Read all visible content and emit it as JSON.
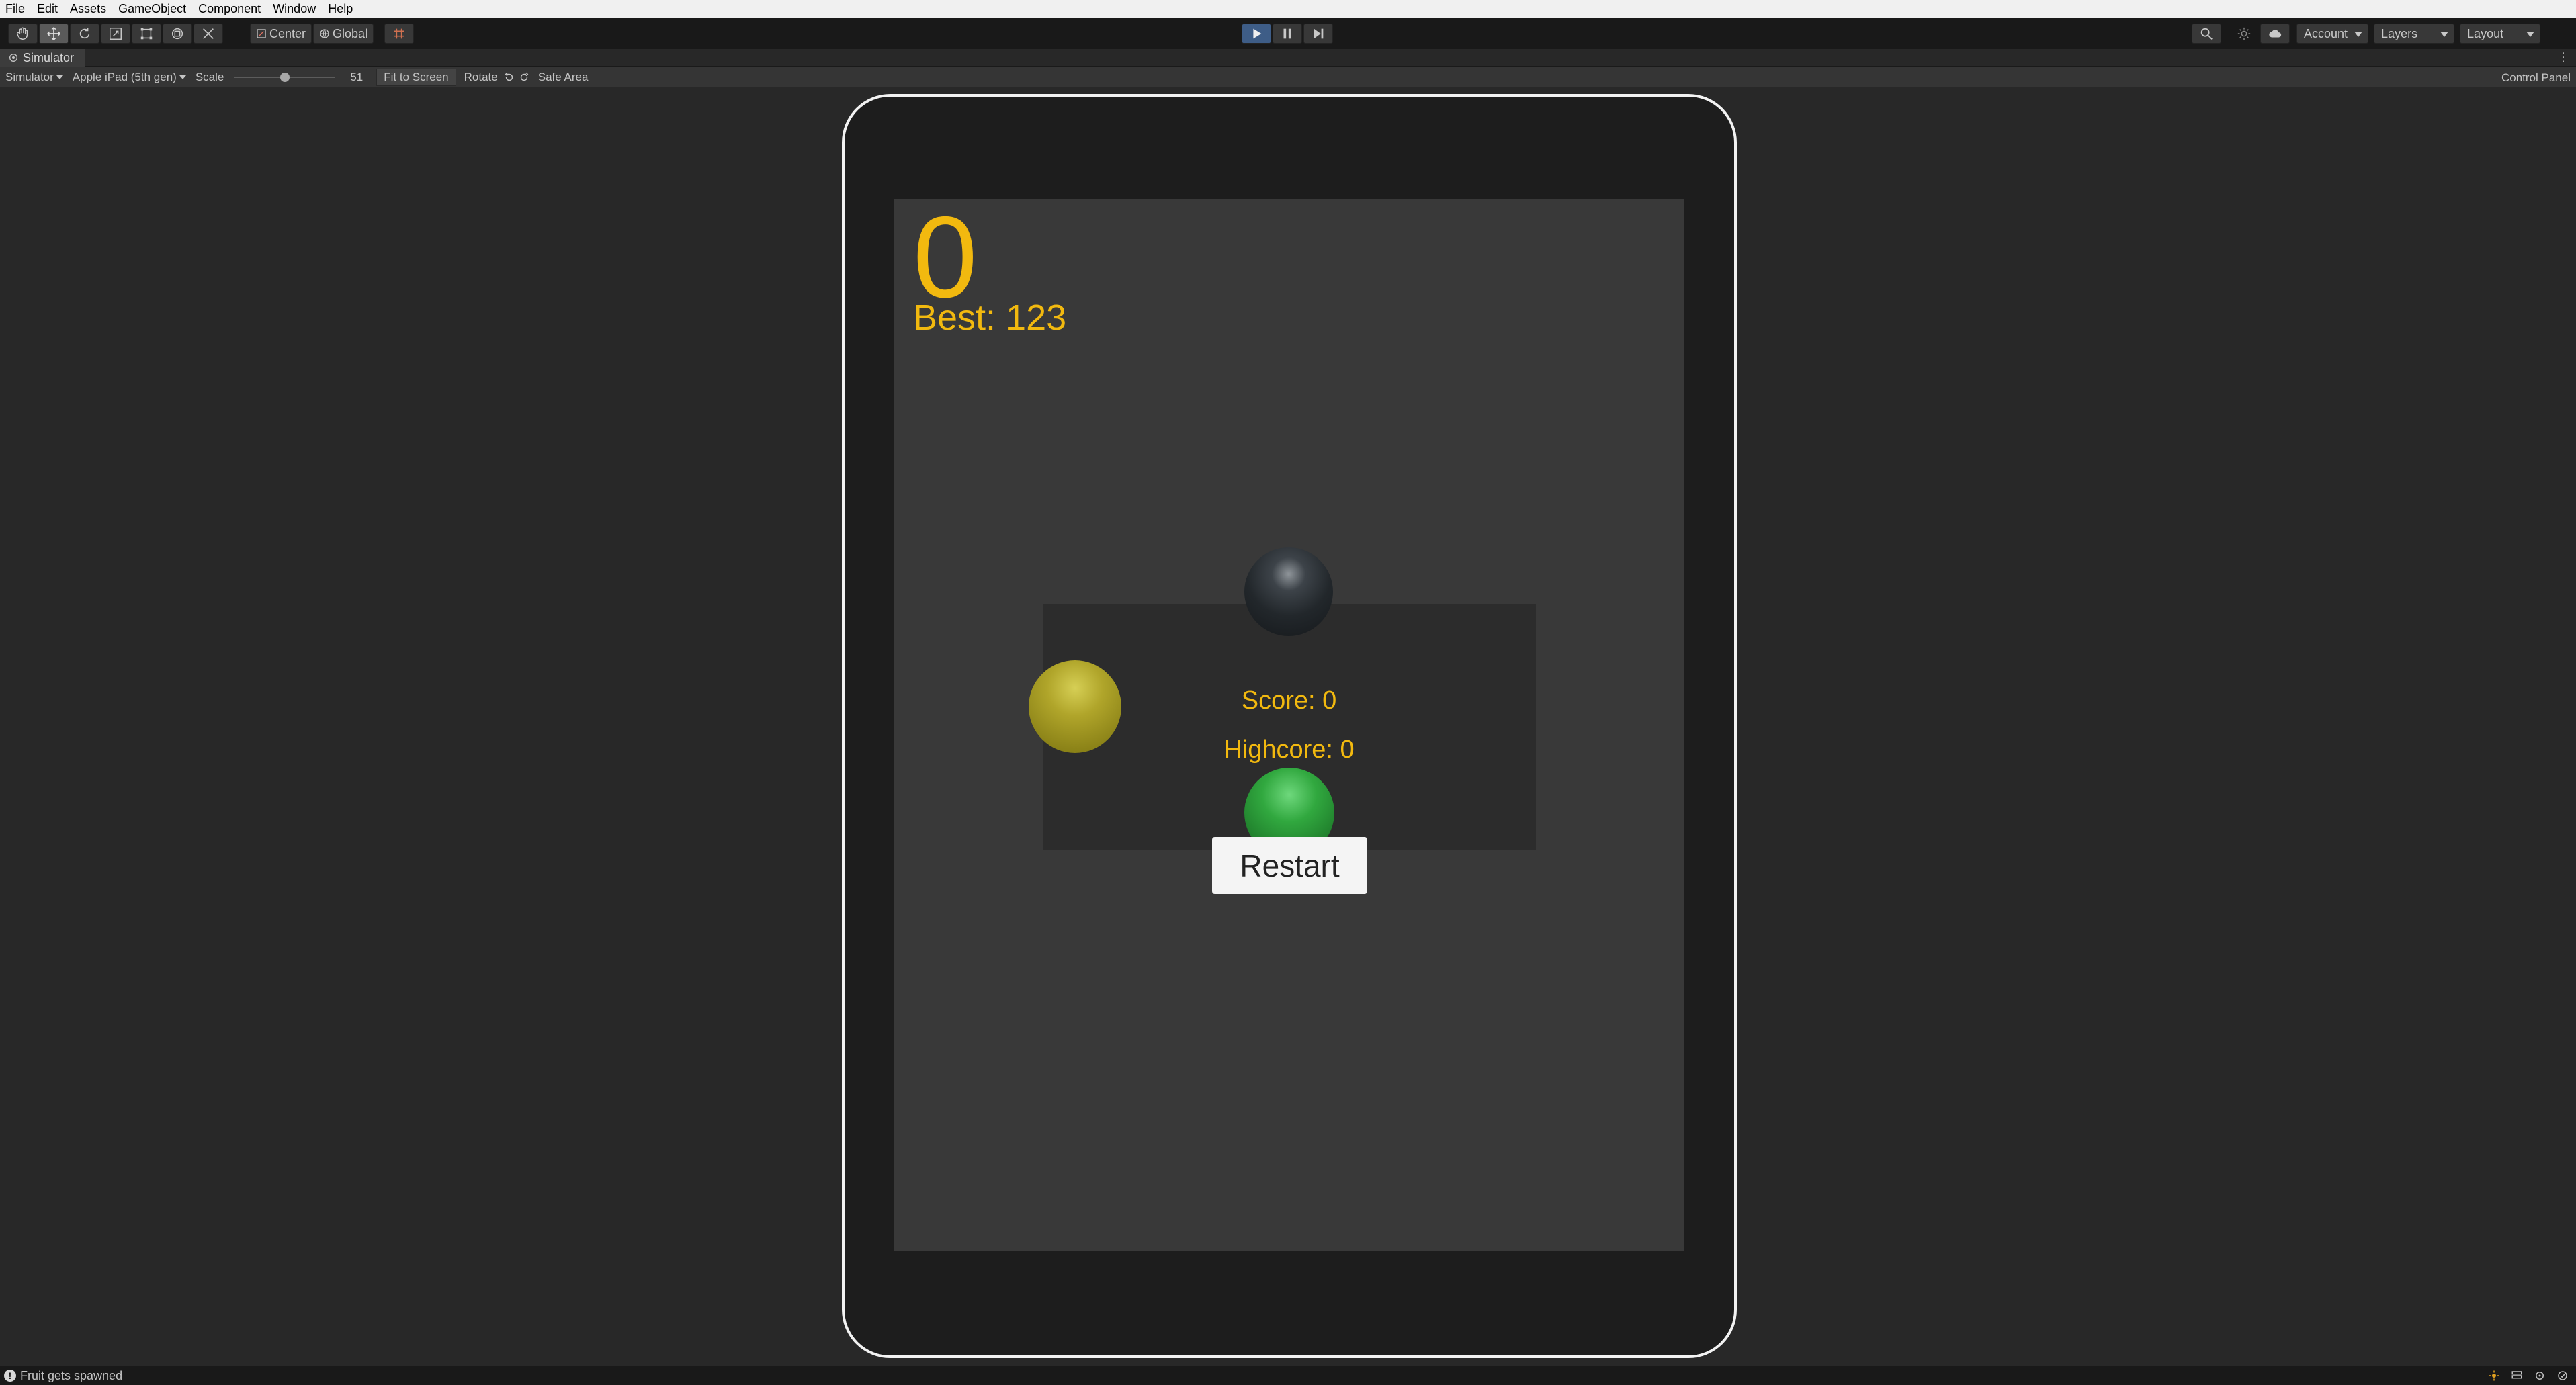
{
  "menubar": {
    "items": [
      "File",
      "Edit",
      "Assets",
      "GameObject",
      "Component",
      "Window",
      "Help"
    ]
  },
  "toolbar": {
    "tools": [
      "hand-tool-icon",
      "move-tool-icon",
      "rotate-tool-icon",
      "scale-tool-icon",
      "rect-tool-icon",
      "transform-tool-icon",
      "custom-tool-icon"
    ],
    "pivot_label": "Center",
    "space_label": "Global",
    "account_label": "Account",
    "layers_label": "Layers",
    "layout_label": "Layout"
  },
  "tab": {
    "title": "Simulator"
  },
  "simbar": {
    "mode": "Simulator",
    "device": "Apple iPad (5th gen)",
    "scale_label": "Scale",
    "scale_value": "51",
    "fit_label": "Fit to Screen",
    "rotate_label": "Rotate",
    "safe_area_label": "Safe Area",
    "control_panel_label": "Control Panel"
  },
  "game": {
    "score": "0",
    "best": "Best: 123",
    "panel_score": "Score: 0",
    "panel_highscore": "Highcore: 0",
    "restart_label": "Restart"
  },
  "status": {
    "message": "Fruit gets spawned"
  },
  "colors": {
    "accent_text": "#f2b90f",
    "play_button": "#3e5d87"
  }
}
